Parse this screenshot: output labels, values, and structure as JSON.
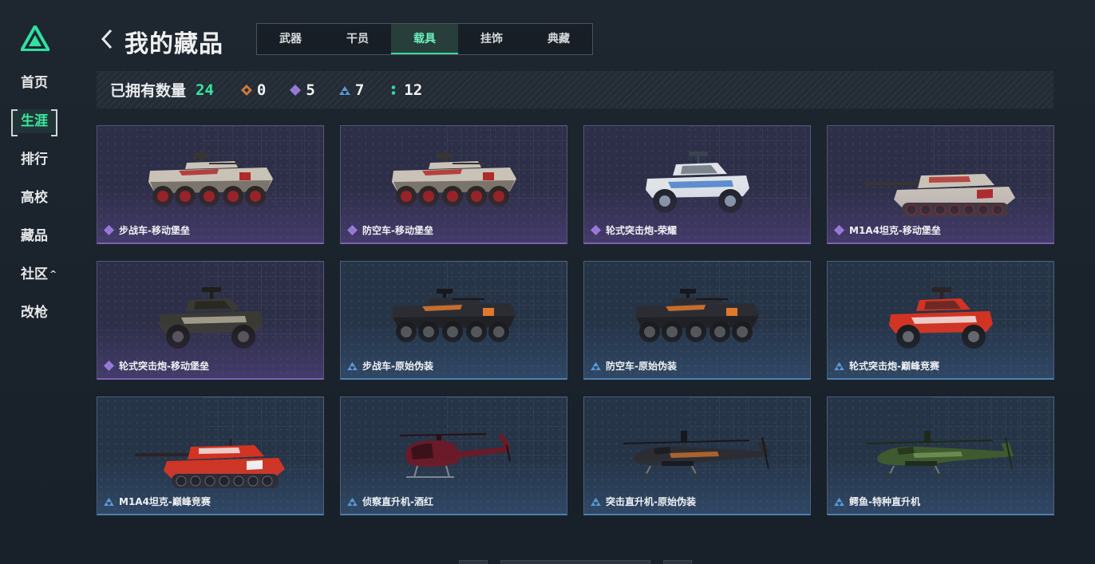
{
  "sidebar": {
    "items": [
      {
        "label": "首页",
        "active": false
      },
      {
        "label": "生涯",
        "active": true
      },
      {
        "label": "排行",
        "active": false
      },
      {
        "label": "高校",
        "active": false
      },
      {
        "label": "藏品",
        "active": false
      },
      {
        "label": "社区",
        "active": false,
        "caret": "^"
      },
      {
        "label": "改枪",
        "active": false
      }
    ]
  },
  "header": {
    "title": "我的藏品",
    "tabs": [
      {
        "label": "武器",
        "active": false
      },
      {
        "label": "干员",
        "active": false
      },
      {
        "label": "载具",
        "active": true
      },
      {
        "label": "挂饰",
        "active": false
      },
      {
        "label": "典藏",
        "active": false
      }
    ]
  },
  "summary": {
    "label": "已拥有数量",
    "total": "24",
    "stats": [
      {
        "icon": "orange-diamond-icon",
        "color": "#d07a3a",
        "value": "0"
      },
      {
        "icon": "purple-diamond-icon",
        "color": "#9a7ad8",
        "value": "5"
      },
      {
        "icon": "blue-triangle-icon",
        "color": "#5a98d6",
        "value": "7"
      },
      {
        "icon": "green-dots-icon",
        "color": "#36d6a0",
        "value": "12"
      }
    ]
  },
  "colors": {
    "accent": "#36e59e",
    "purple": "#9a7ad8",
    "blue": "#5a98d6"
  },
  "cards": [
    {
      "name": "步战车-移动堡垒",
      "rarity": "purple",
      "vehicle": "ifv",
      "skin": "red-white"
    },
    {
      "name": "防空车-移动堡垒",
      "rarity": "purple",
      "vehicle": "ifv",
      "skin": "red-white"
    },
    {
      "name": "轮式突击炮-荣耀",
      "rarity": "purple",
      "vehicle": "buggy",
      "skin": "white-blue"
    },
    {
      "name": "M1A4坦克-移动堡垒",
      "rarity": "purple",
      "vehicle": "tank",
      "skin": "red-white"
    },
    {
      "name": "轮式突击炮-移动堡垒",
      "rarity": "purple",
      "vehicle": "buggy",
      "skin": "dark"
    },
    {
      "name": "步战车-原始伪装",
      "rarity": "blue",
      "vehicle": "ifv",
      "skin": "orange"
    },
    {
      "name": "防空车-原始伪装",
      "rarity": "blue",
      "vehicle": "ifv",
      "skin": "orange"
    },
    {
      "name": "轮式突击炮-巅峰竞赛",
      "rarity": "blue",
      "vehicle": "buggy",
      "skin": "red"
    },
    {
      "name": "M1A4坦克-巅峰竞赛",
      "rarity": "blue",
      "vehicle": "tank",
      "skin": "red"
    },
    {
      "name": "侦察直升机-酒红",
      "rarity": "blue",
      "vehicle": "heli-small",
      "skin": "maroon"
    },
    {
      "name": "突击直升机-原始伪装",
      "rarity": "blue",
      "vehicle": "heli",
      "skin": "orange"
    },
    {
      "name": "鳄鱼-特种直升机",
      "rarity": "blue",
      "vehicle": "heli",
      "skin": "green"
    }
  ]
}
